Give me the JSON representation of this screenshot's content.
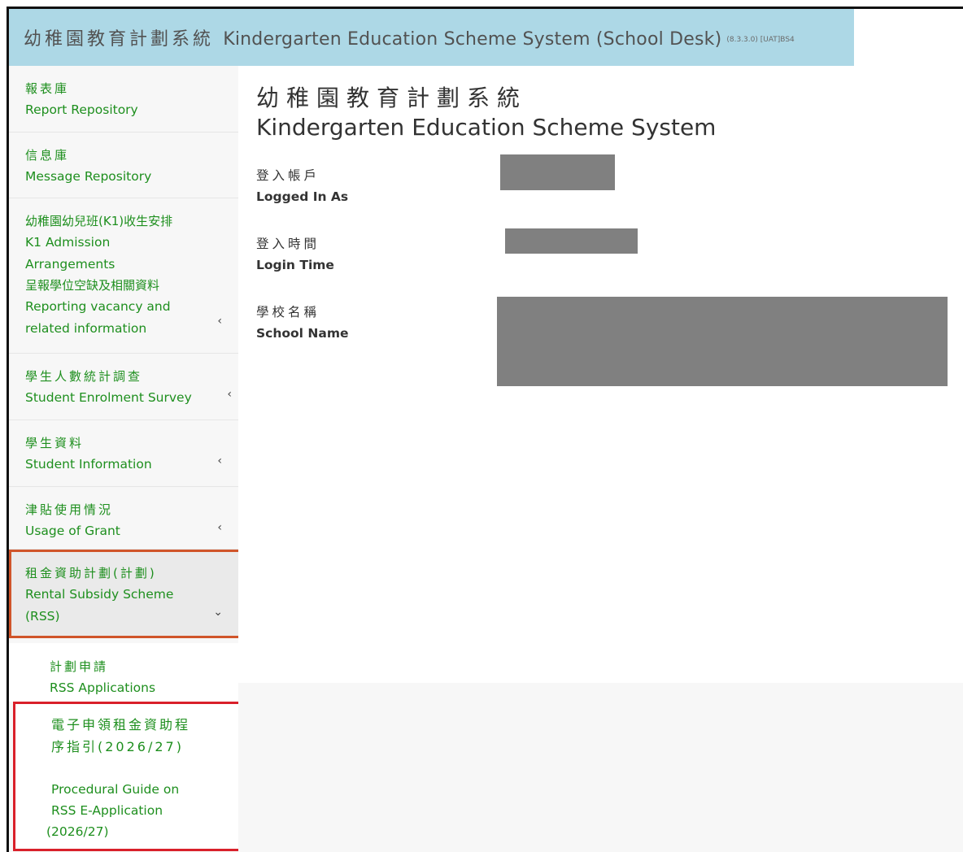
{
  "header": {
    "title_zh": "幼稚園教育計劃系統",
    "title_en": "Kindergarten Education Scheme System (School Desk)",
    "version": "(8.3.3.0) [UAT]BS4",
    "bg_color": "#add8e6"
  },
  "sidebar": {
    "items": [
      {
        "zh": "報表庫",
        "en": "Report Repository"
      },
      {
        "zh": "信息庫",
        "en": "Message Repository"
      },
      {
        "zh": "幼稚園幼兒班(K1)收生安排",
        "en1": "K1 Admission",
        "en2": "Arrangements",
        "zh2": "呈報學位空缺及相關資料",
        "en3": "Reporting vacancy and",
        "en4": "related information",
        "chevron": "‹"
      },
      {
        "zh": "學生人數統計調查",
        "en": "Student Enrolment Survey",
        "chevron": "‹"
      },
      {
        "zh": "學生資料",
        "en": "Student Information",
        "chevron": "‹"
      },
      {
        "zh": "津貼使用情況",
        "en": "Usage of Grant",
        "chevron": "‹"
      },
      {
        "zh": "租金資助計劃(計劃)",
        "en1": "Rental Subsidy Scheme",
        "en2": "(RSS)",
        "chevron": "⌄"
      }
    ],
    "sub_items": [
      {
        "zh": "計劃申請",
        "en": "RSS Applications"
      }
    ],
    "guide": {
      "zh1": "電子申領租金資助程",
      "zh2": "序指引(2026/27)",
      "en1": "Procedural Guide on",
      "en2": "RSS E-Application",
      "en3": "(2026/27)"
    },
    "link_color": "#1e8f1e"
  },
  "main": {
    "title_zh": "幼稚園教育計劃系統",
    "title_en": "Kindergarten Education Scheme System",
    "fields": [
      {
        "zh": "登入帳戶",
        "en": "Logged In As"
      },
      {
        "zh": "登入時間",
        "en": "Login Time"
      },
      {
        "zh": "學校名稱",
        "en": "School Name"
      }
    ]
  }
}
